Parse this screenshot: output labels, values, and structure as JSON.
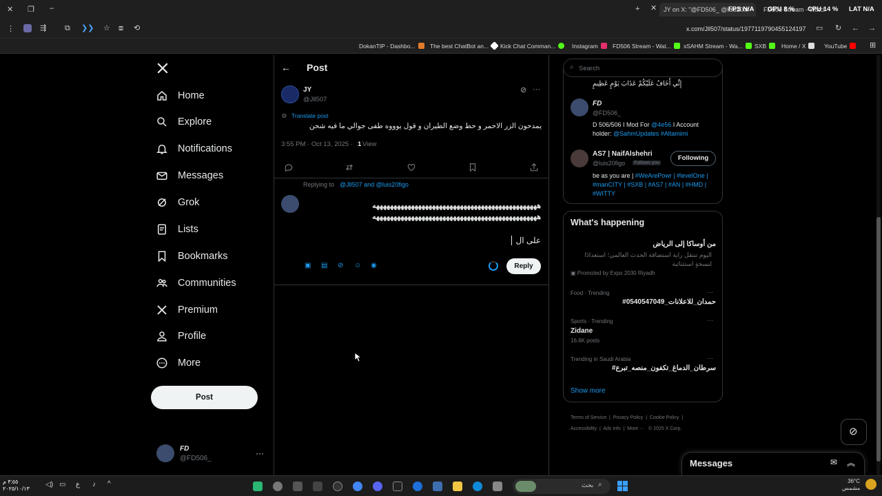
{
  "browser": {
    "tabs": [
      {
        "label": "JY on X: \"@FD506_ @luis20..."
      },
      {
        "label": "FD506 Stream - Watch Live o..."
      }
    ],
    "perf_overlay": {
      "fps": "FPS N/A",
      "gpu": "GPU 8 %",
      "cpu": "CPU 14 %",
      "lat": "LAT N/A"
    },
    "url": "x.com/Jll507/status/1977119790455124197",
    "bookmarks": [
      {
        "label": "DokanTIP - Dashbo...",
        "color": "#e07b2a"
      },
      {
        "label": "The best ChatBot an...",
        "color": "#ffffff"
      },
      {
        "label": "Kick Chat Comman...",
        "color": "#53fc18"
      },
      {
        "label": "Instagram",
        "color": "#e1306c"
      },
      {
        "label": "FD506 Stream - Wat...",
        "color": "#53fc18"
      },
      {
        "label": "sSAHM Stream - Wa...",
        "color": "#53fc18"
      },
      {
        "label": "SXB",
        "color": "#53fc18"
      },
      {
        "label": "Home / X",
        "color": "#ffffff"
      },
      {
        "label": "YouTube",
        "color": "#ff0000"
      }
    ]
  },
  "nav": {
    "items": [
      {
        "label": "Home",
        "icon": "home-icon"
      },
      {
        "label": "Explore",
        "icon": "search-icon"
      },
      {
        "label": "Notifications",
        "icon": "bell-icon"
      },
      {
        "label": "Messages",
        "icon": "mail-icon"
      },
      {
        "label": "Grok",
        "icon": "grok-icon"
      },
      {
        "label": "Lists",
        "icon": "list-icon"
      },
      {
        "label": "Bookmarks",
        "icon": "bookmark-icon"
      },
      {
        "label": "Communities",
        "icon": "people-icon"
      },
      {
        "label": "Premium",
        "icon": "x-icon"
      },
      {
        "label": "Profile",
        "icon": "person-icon"
      },
      {
        "label": "More",
        "icon": "more-circle-icon"
      }
    ],
    "post_button": "Post",
    "account": {
      "name": "FD",
      "handle": "@FD506_"
    }
  },
  "post": {
    "header": "Post",
    "author_name": "JY",
    "author_handle": "@Jll507",
    "translate": "Translate post",
    "text": "يمدحون الزر الاحمر و حط وضع الطيران و قول يوووه طفى جوالي ما فيه شحن",
    "timestamp": "3:55 PM · Oct 13, 2025 ·",
    "views_count": "1",
    "views_label": "View",
    "replying_prefix": "Replying to",
    "replying_users": "@Jll507 and @luis20figo",
    "reply_line1": "هههههههههههههههههههههههههههههههههههههههههههههههه",
    "reply_line2": "هههههههههههههههههههههههههههههههههههههههههههههههه",
    "reply_line3": "على ال",
    "reply_button": "Reply"
  },
  "right": {
    "search_placeholder": "Search",
    "bio_top": "إِنِّي أَخَافُ عَلَيْكُمْ عَذَابَ يَوْمٍ عَظِيمٍ",
    "people": [
      {
        "name": "FD",
        "handle": "@FD506_",
        "bio_plain": "D 506/506 I Mod For",
        "bio_link1": "@4e56",
        "bio_plain2": "I Account holder:",
        "bio_link2": "@SahmUpdates #Altamimi"
      },
      {
        "name": "AS7 | NaifAlshehri",
        "handle": "@luis20figo",
        "follows_you": "Follows you",
        "follow_button": "Following",
        "bio_plain": "be as you are |",
        "bio_links": "#WeArePowr | #levelOne | #manCITY | #SXB | #AS7 | #AN | #HMD | #WITTY"
      }
    ],
    "whats_happening": "What's happening",
    "promo": {
      "title": "من أوساكا إلى الرياض",
      "desc": "اليوم تنتقل راية استضافة الحدث العالمي؛ استعدادًا لنسخةٍ استثنائية",
      "promoted": "Promoted by Expo 2030 Riyadh"
    },
    "trends": [
      {
        "meta": "Food · Trending",
        "title": "#حمدان_للاعلانات_0540547049",
        "posts": ""
      },
      {
        "meta": "Sports · Trending",
        "title": "Zidane",
        "posts": "16.6K posts"
      },
      {
        "meta": "Trending in Saudi Arabia",
        "title": "#سرطان_الدماغ_تكفون_منصه_تبرع",
        "posts": ""
      }
    ],
    "show_more": "Show more",
    "footer": [
      "Terms of Service",
      "Privacy Policy",
      "Cookie Policy",
      "Accessibility",
      "Ads info",
      "More ···",
      "© 2025 X Corp."
    ],
    "messages_title": "Messages"
  },
  "taskbar": {
    "search_placeholder": "بحث",
    "time": "٣:٥٥ م",
    "date": "٢٠٢٥/١٠/١٣",
    "weather_temp": "36°C",
    "weather_desc": "مشمس"
  },
  "colors": {
    "accent": "#1d9bf0",
    "bg": "#000000",
    "border": "#2f3336"
  }
}
